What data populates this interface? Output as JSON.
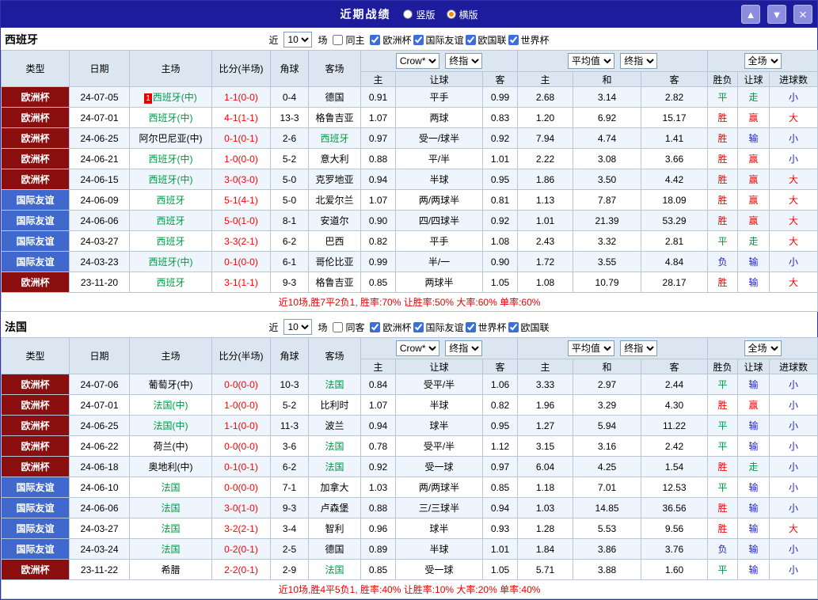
{
  "topbar": {
    "title": "近期战绩",
    "views": [
      {
        "label": "竖版",
        "selected": false
      },
      {
        "label": "横版",
        "selected": true
      }
    ],
    "up_icon": "▲",
    "down_icon": "▼",
    "close_icon": "×"
  },
  "header": {
    "type": "类型",
    "date": "日期",
    "home": "主场",
    "score": "比分(半场)",
    "corner": "角球",
    "away": "客场",
    "odds_source": "Crow*",
    "odds_final": "终指",
    "odds_home": "主",
    "odds_handicap": "让球",
    "odds_away": "客",
    "avg_source": "平均值",
    "avg_final": "终指",
    "avg_home": "主",
    "avg_draw": "和",
    "avg_away": "客",
    "scope": "全场",
    "result": "胜负",
    "handicap_result": "让球",
    "goals": "进球数"
  },
  "sections": [
    {
      "team": "西班牙",
      "filter": {
        "near": "近",
        "count": "10",
        "matches": "场",
        "same": "同主",
        "same_checked": false,
        "competitions": [
          {
            "label": "欧洲杯",
            "checked": true
          },
          {
            "label": "国际友谊",
            "checked": true
          },
          {
            "label": "欧国联",
            "checked": true
          },
          {
            "label": "世界杯",
            "checked": true
          }
        ]
      },
      "rows": [
        {
          "type": "欧洲杯",
          "date": "24-07-05",
          "rank": "1",
          "home": "西班牙(中)",
          "score": "1-1(0-0)",
          "corner": "0-4",
          "away": "德国",
          "odds_home": "0.91",
          "handicap": "平手",
          "odds_away": "0.99",
          "avg_home": "2.68",
          "avg_draw": "3.14",
          "avg_away": "2.82",
          "result": "平",
          "handicap_result": "走",
          "goals": "小"
        },
        {
          "type": "欧洲杯",
          "date": "24-07-01",
          "home": "西班牙(中)",
          "score": "4-1(1-1)",
          "corner": "13-3",
          "away": "格鲁吉亚",
          "odds_home": "1.07",
          "handicap": "两球",
          "odds_away": "0.83",
          "avg_home": "1.20",
          "avg_draw": "6.92",
          "avg_away": "15.17",
          "result": "胜",
          "handicap_result": "赢",
          "goals": "大"
        },
        {
          "type": "欧洲杯",
          "date": "24-06-25",
          "home": "阿尔巴尼亚(中)",
          "score": "0-1(0-1)",
          "corner": "2-6",
          "away": "西班牙",
          "odds_home": "0.97",
          "handicap": "受一/球半",
          "odds_away": "0.92",
          "avg_home": "7.94",
          "avg_draw": "4.74",
          "avg_away": "1.41",
          "result": "胜",
          "handicap_result": "输",
          "goals": "小"
        },
        {
          "type": "欧洲杯",
          "date": "24-06-21",
          "home": "西班牙(中)",
          "score": "1-0(0-0)",
          "corner": "5-2",
          "away": "意大利",
          "odds_home": "0.88",
          "handicap": "平/半",
          "odds_away": "1.01",
          "avg_home": "2.22",
          "avg_draw": "3.08",
          "avg_away": "3.66",
          "result": "胜",
          "handicap_result": "赢",
          "goals": "小"
        },
        {
          "type": "欧洲杯",
          "date": "24-06-15",
          "home": "西班牙(中)",
          "score": "3-0(3-0)",
          "corner": "5-0",
          "away": "克罗地亚",
          "odds_home": "0.94",
          "handicap": "半球",
          "odds_away": "0.95",
          "avg_home": "1.86",
          "avg_draw": "3.50",
          "avg_away": "4.42",
          "result": "胜",
          "handicap_result": "赢",
          "goals": "大"
        },
        {
          "type": "国际友谊",
          "date": "24-06-09",
          "home": "西班牙",
          "score": "5-1(4-1)",
          "corner": "5-0",
          "away": "北爱尔兰",
          "odds_home": "1.07",
          "handicap": "两/两球半",
          "odds_away": "0.81",
          "avg_home": "1.13",
          "avg_draw": "7.87",
          "avg_away": "18.09",
          "result": "胜",
          "handicap_result": "赢",
          "goals": "大"
        },
        {
          "type": "国际友谊",
          "date": "24-06-06",
          "home": "西班牙",
          "score": "5-0(1-0)",
          "corner": "8-1",
          "away": "安道尔",
          "odds_home": "0.90",
          "handicap": "四/四球半",
          "odds_away": "0.92",
          "avg_home": "1.01",
          "avg_draw": "21.39",
          "avg_away": "53.29",
          "result": "胜",
          "handicap_result": "赢",
          "goals": "大"
        },
        {
          "type": "国际友谊",
          "date": "24-03-27",
          "home": "西班牙",
          "score": "3-3(2-1)",
          "corner": "6-2",
          "away": "巴西",
          "odds_home": "0.82",
          "handicap": "平手",
          "odds_away": "1.08",
          "avg_home": "2.43",
          "avg_draw": "3.32",
          "avg_away": "2.81",
          "result": "平",
          "handicap_result": "走",
          "goals": "大"
        },
        {
          "type": "国际友谊",
          "date": "24-03-23",
          "home": "西班牙(中)",
          "score": "0-1(0-0)",
          "corner": "6-1",
          "away": "哥伦比亚",
          "odds_home": "0.99",
          "handicap": "半/一",
          "odds_away": "0.90",
          "avg_home": "1.72",
          "avg_draw": "3.55",
          "avg_away": "4.84",
          "result": "负",
          "handicap_result": "输",
          "goals": "小"
        },
        {
          "type": "欧洲杯",
          "date": "23-11-20",
          "home": "西班牙",
          "score": "3-1(1-1)",
          "corner": "9-3",
          "away": "格鲁吉亚",
          "odds_home": "0.85",
          "handicap": "两球半",
          "odds_away": "1.05",
          "avg_home": "1.08",
          "avg_draw": "10.79",
          "avg_away": "28.17",
          "result": "胜",
          "handicap_result": "输",
          "goals": "大"
        }
      ],
      "summary": "近10场,胜7平2负1, 胜率:70% 让胜率:50% 大率:60% 单率:60%"
    },
    {
      "team": "法国",
      "filter": {
        "near": "近",
        "count": "10",
        "matches": "场",
        "same": "同客",
        "same_checked": false,
        "competitions": [
          {
            "label": "欧洲杯",
            "checked": true
          },
          {
            "label": "国际友谊",
            "checked": true
          },
          {
            "label": "世界杯",
            "checked": true
          },
          {
            "label": "欧国联",
            "checked": true
          }
        ]
      },
      "rows": [
        {
          "type": "欧洲杯",
          "date": "24-07-06",
          "home": "葡萄牙(中)",
          "score": "0-0(0-0)",
          "corner": "10-3",
          "away": "法国",
          "odds_home": "0.84",
          "handicap": "受平/半",
          "odds_away": "1.06",
          "avg_home": "3.33",
          "avg_draw": "2.97",
          "avg_away": "2.44",
          "result": "平",
          "handicap_result": "输",
          "goals": "小"
        },
        {
          "type": "欧洲杯",
          "date": "24-07-01",
          "home": "法国(中)",
          "score": "1-0(0-0)",
          "corner": "5-2",
          "away": "比利时",
          "odds_home": "1.07",
          "handicap": "半球",
          "odds_away": "0.82",
          "avg_home": "1.96",
          "avg_draw": "3.29",
          "avg_away": "4.30",
          "result": "胜",
          "handicap_result": "赢",
          "goals": "小"
        },
        {
          "type": "欧洲杯",
          "date": "24-06-25",
          "home": "法国(中)",
          "score": "1-1(0-0)",
          "corner": "11-3",
          "away": "波兰",
          "odds_home": "0.94",
          "handicap": "球半",
          "odds_away": "0.95",
          "avg_home": "1.27",
          "avg_draw": "5.94",
          "avg_away": "11.22",
          "result": "平",
          "handicap_result": "输",
          "goals": "小"
        },
        {
          "type": "欧洲杯",
          "date": "24-06-22",
          "home": "荷兰(中)",
          "score": "0-0(0-0)",
          "corner": "3-6",
          "away": "法国",
          "odds_home": "0.78",
          "handicap": "受平/半",
          "odds_away": "1.12",
          "avg_home": "3.15",
          "avg_draw": "3.16",
          "avg_away": "2.42",
          "result": "平",
          "handicap_result": "输",
          "goals": "小"
        },
        {
          "type": "欧洲杯",
          "date": "24-06-18",
          "home": "奥地利(中)",
          "score": "0-1(0-1)",
          "corner": "6-2",
          "away": "法国",
          "odds_home": "0.92",
          "handicap": "受一球",
          "odds_away": "0.97",
          "avg_home": "6.04",
          "avg_draw": "4.25",
          "avg_away": "1.54",
          "result": "胜",
          "handicap_result": "走",
          "goals": "小"
        },
        {
          "type": "国际友谊",
          "date": "24-06-10",
          "home": "法国",
          "score": "0-0(0-0)",
          "corner": "7-1",
          "away": "加拿大",
          "odds_home": "1.03",
          "handicap": "两/两球半",
          "odds_away": "0.85",
          "avg_home": "1.18",
          "avg_draw": "7.01",
          "avg_away": "12.53",
          "result": "平",
          "handicap_result": "输",
          "goals": "小"
        },
        {
          "type": "国际友谊",
          "date": "24-06-06",
          "home": "法国",
          "score": "3-0(1-0)",
          "corner": "9-3",
          "away": "卢森堡",
          "odds_home": "0.88",
          "handicap": "三/三球半",
          "odds_away": "0.94",
          "avg_home": "1.03",
          "avg_draw": "14.85",
          "avg_away": "36.56",
          "result": "胜",
          "handicap_result": "输",
          "goals": "小"
        },
        {
          "type": "国际友谊",
          "date": "24-03-27",
          "home": "法国",
          "score": "3-2(2-1)",
          "corner": "3-4",
          "away": "智利",
          "odds_home": "0.96",
          "handicap": "球半",
          "odds_away": "0.93",
          "avg_home": "1.28",
          "avg_draw": "5.53",
          "avg_away": "9.56",
          "result": "胜",
          "handicap_result": "输",
          "goals": "大"
        },
        {
          "type": "国际友谊",
          "date": "24-03-24",
          "home": "法国",
          "score": "0-2(0-1)",
          "corner": "2-5",
          "away": "德国",
          "odds_home": "0.89",
          "handicap": "半球",
          "odds_away": "1.01",
          "avg_home": "1.84",
          "avg_draw": "3.86",
          "avg_away": "3.76",
          "result": "负",
          "handicap_result": "输",
          "goals": "小"
        },
        {
          "type": "欧洲杯",
          "date": "23-11-22",
          "home": "希腊",
          "score": "2-2(0-1)",
          "corner": "2-9",
          "away": "法国",
          "odds_home": "0.85",
          "handicap": "受一球",
          "odds_away": "1.05",
          "avg_home": "5.71",
          "avg_draw": "3.88",
          "avg_away": "1.60",
          "result": "平",
          "handicap_result": "输",
          "goals": "小"
        }
      ],
      "summary": "近10场,胜4平5负1, 胜率:40% 让胜率:10% 大率:20% 单率:40%"
    }
  ],
  "colors": {
    "topbar_bg": "#1c1c9c",
    "euro_cup_bg": "#8c0f0f",
    "friendly_bg": "#4169cd",
    "header_bg": "#dce6f1",
    "row_alt_bg": "#eff5fc",
    "win_color": "#ff0000",
    "draw_color": "#009944",
    "lose_color": "#2222cc",
    "score_color": "#ff0000",
    "focus_team_color": "#009944",
    "summary_color": "#e60000",
    "selected_radio_color": "#ff8a00"
  }
}
